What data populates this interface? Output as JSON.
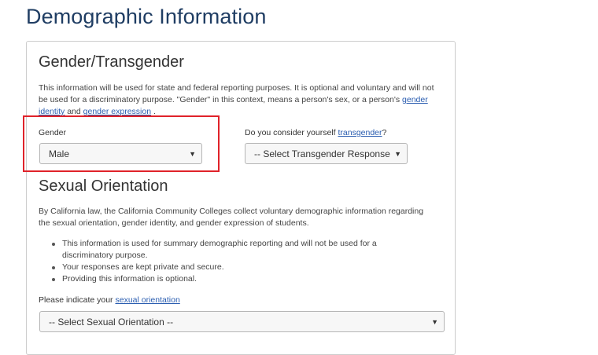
{
  "page_title": "Demographic Information",
  "gender_section": {
    "heading": "Gender/Transgender",
    "intro_text": "This information will be used for state and federal reporting purposes. It is optional and voluntary and will not be used for a discriminatory purpose. \"Gender\" in this context, means a person's sex, or a person's",
    "gender_identity_link": "gender identity",
    "and_text": "and",
    "gender_expression_link": "gender expression",
    "period": ".",
    "gender_label": "Gender",
    "gender_value": "Male",
    "transgender_label_prefix": "Do you consider yourself",
    "transgender_link": "transgender",
    "transgender_label_suffix": "?",
    "transgender_value": "-- Select Transgender Response"
  },
  "sexual_orientation_section": {
    "heading": "Sexual Orientation",
    "intro_text": "By California law, the California Community Colleges collect voluntary demographic information regarding the sexual orientation, gender identity, and gender expression of students.",
    "bullets": [
      "This information is used for summary demographic reporting and will not be used for a discriminatory purpose.",
      "Your responses are kept private and secure.",
      "Providing this information is optional."
    ],
    "indicate_label_prefix": "Please indicate your",
    "sexual_orientation_link": "sexual orientation",
    "select_value": "-- Select Sexual Orientation --"
  },
  "colors": {
    "title": "#1f3d63",
    "link": "#2a5db0",
    "highlight": "#e0222a"
  },
  "icons": {
    "select_arrow": "caret-down-icon"
  }
}
